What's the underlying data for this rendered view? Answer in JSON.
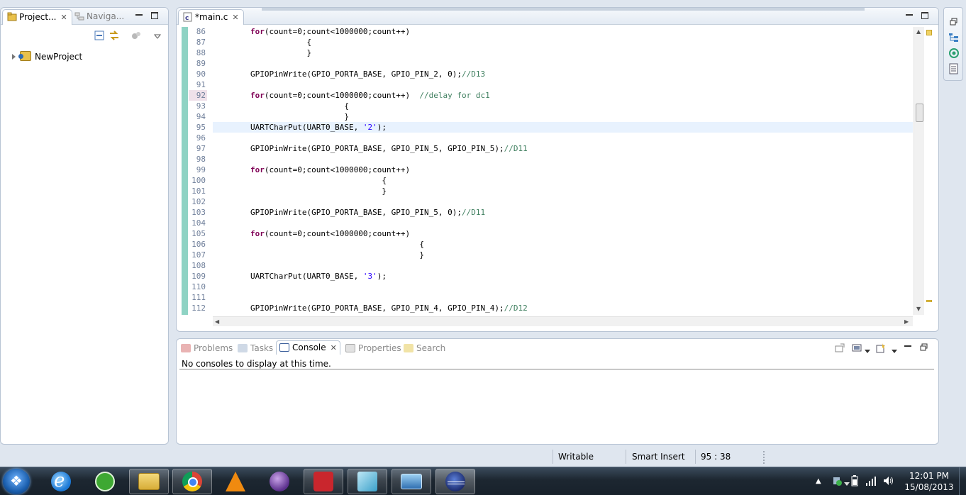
{
  "project_panel": {
    "tab_project": "Project...",
    "tab_navigator": "Naviga...",
    "tree_root": "NewProject"
  },
  "editor": {
    "tab_title": "*main.c",
    "current_line": 95,
    "lines": [
      {
        "n": "86",
        "html": "        <span class='kw'>for</span>(count=0;count&lt;1000000;count++)"
      },
      {
        "n": "87",
        "html": "                    {"
      },
      {
        "n": "88",
        "html": "                    }"
      },
      {
        "n": "89",
        "html": ""
      },
      {
        "n": "90",
        "html": "        GPIOPinWrite(GPIO_PORTA_BASE, GPIO_PIN_2, 0);<span class='cm'>//D13</span>"
      },
      {
        "n": "91",
        "html": ""
      },
      {
        "n": "92",
        "html": "        <span class='kw'>for</span>(count=0;count&lt;1000000;count++)  <span class='cm'>//delay for dc1</span>"
      },
      {
        "n": "93",
        "html": "                            {"
      },
      {
        "n": "94",
        "html": "                            }"
      },
      {
        "n": "95",
        "html": "        UARTCharPut(UART0_BASE, <span class='st'>'2'</span>);"
      },
      {
        "n": "96",
        "html": ""
      },
      {
        "n": "97",
        "html": "        GPIOPinWrite(GPIO_PORTA_BASE, GPIO_PIN_5, GPIO_PIN_5);<span class='cm'>//D11</span>"
      },
      {
        "n": "98",
        "html": ""
      },
      {
        "n": "99",
        "html": "        <span class='kw'>for</span>(count=0;count&lt;1000000;count++)"
      },
      {
        "n": "100",
        "html": "                                    {"
      },
      {
        "n": "101",
        "html": "                                    }"
      },
      {
        "n": "102",
        "html": ""
      },
      {
        "n": "103",
        "html": "        GPIOPinWrite(GPIO_PORTA_BASE, GPIO_PIN_5, 0);<span class='cm'>//D11</span>"
      },
      {
        "n": "104",
        "html": ""
      },
      {
        "n": "105",
        "html": "        <span class='kw'>for</span>(count=0;count&lt;1000000;count++)"
      },
      {
        "n": "106",
        "html": "                                            {"
      },
      {
        "n": "107",
        "html": "                                            }"
      },
      {
        "n": "108",
        "html": ""
      },
      {
        "n": "109",
        "html": "        UARTCharPut(UART0_BASE, <span class='st'>'3'</span>);"
      },
      {
        "n": "110",
        "html": ""
      },
      {
        "n": "111",
        "html": ""
      },
      {
        "n": "112",
        "html": "        GPIOPinWrite(GPIO_PORTA_BASE, GPIO_PIN_4, GPIO_PIN_4);<span class='cm'>//D12</span>"
      }
    ]
  },
  "console_panel": {
    "tab_problems": "Problems",
    "tab_tasks": "Tasks",
    "tab_console": "Console",
    "tab_properties": "Properties",
    "tab_search": "Search",
    "message": "No consoles to display at this time."
  },
  "status_bar": {
    "writable": "Writable",
    "insert_mode": "Smart Insert",
    "position": "95 : 38"
  },
  "taskbar": {
    "time": "12:01 PM",
    "date": "15/08/2013"
  },
  "icons": {
    "start": "windows-start-icon",
    "ie": "internet-explorer-icon",
    "utorrent": "utorrent-icon",
    "explorer": "file-explorer-icon",
    "chrome": "chrome-icon",
    "vlc": "vlc-icon",
    "eclipse_purple": "eclipse-icon",
    "filezilla": "network-tool-icon",
    "app_cyan": "app-icon",
    "remote": "remote-desktop-icon",
    "eclipse_active": "eclipse-icon"
  },
  "colors": {
    "keyword": "#7f0055",
    "comment": "#3f7f5f",
    "string": "#2a00ff",
    "current_line": "#e8f2fe",
    "ruler": "#8fd3c4"
  }
}
